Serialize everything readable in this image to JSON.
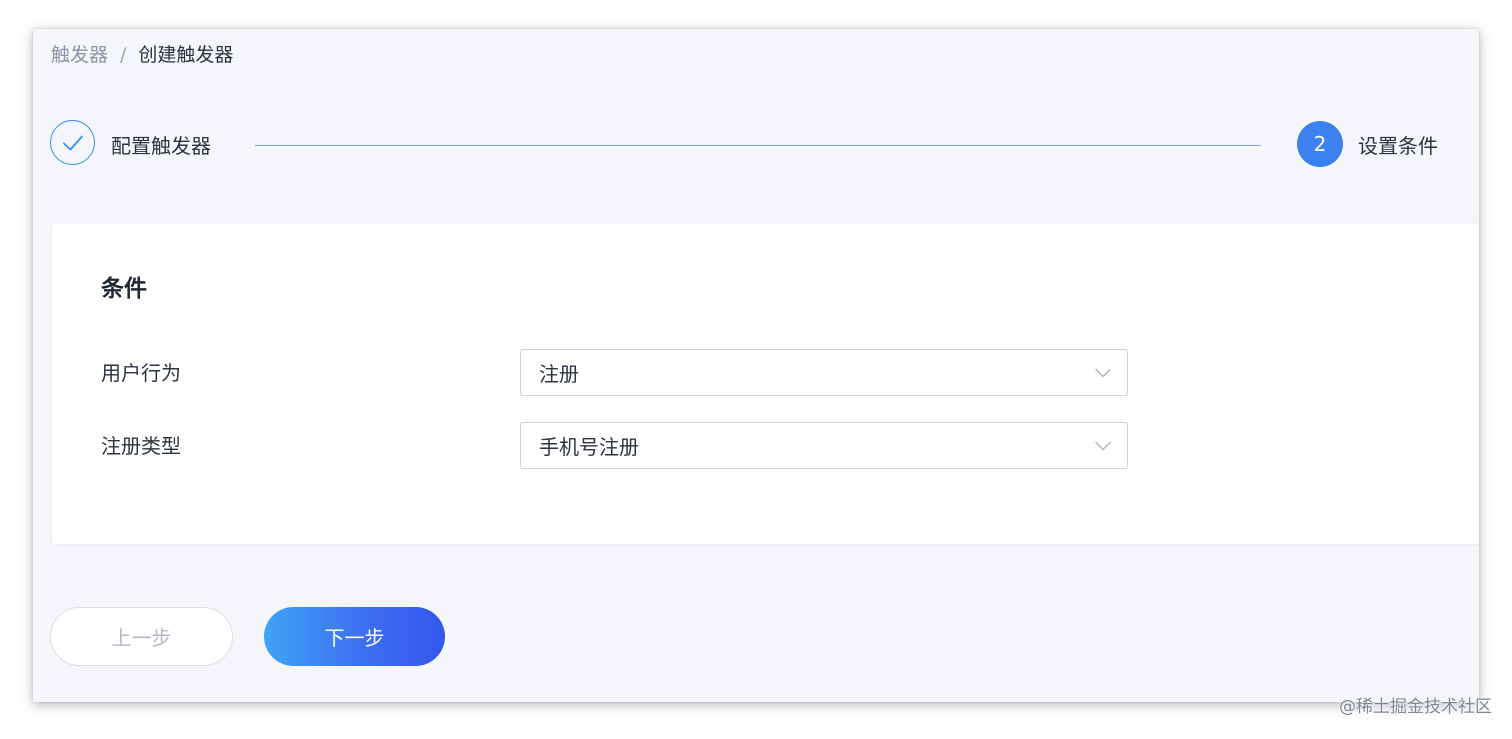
{
  "breadcrumb": {
    "parent": "触发器",
    "separator": "/",
    "current": "创建触发器"
  },
  "steps": [
    {
      "label": "配置触发器",
      "status": "done",
      "icon": "check-icon"
    },
    {
      "number": "2",
      "label": "设置条件",
      "status": "active"
    }
  ],
  "card": {
    "title": "条件",
    "fields": [
      {
        "label": "用户行为",
        "value": "注册"
      },
      {
        "label": "注册类型",
        "value": "手机号注册"
      }
    ]
  },
  "buttons": {
    "prev_label": "上一步",
    "next_label": "下一步"
  },
  "watermark": "@稀土掘金技术社区",
  "colors": {
    "accent": "#3b82f0",
    "text": "#2c3442",
    "muted": "#8a95a8",
    "background": "#f5f6fa"
  }
}
